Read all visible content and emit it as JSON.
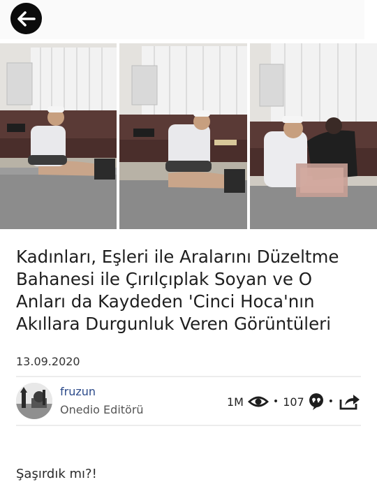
{
  "header": {
    "back_icon": "arrow-left-icon"
  },
  "article": {
    "title": "Kadınları, Eşleri ile Aralarını Düzeltme Bahanesi ile Çırılçıplak Soyan ve O Anları da Kaydeden 'Cinci Hoca'nın Akıllara Durgunluk Veren Görüntüleri",
    "date": "13.09.2020",
    "lead": "Şaşırdık mı?!"
  },
  "author": {
    "name": "fruzun",
    "role": "Onedio Editörü"
  },
  "stats": {
    "views": "1M",
    "views_icon": "eye-icon",
    "comments": "107",
    "comments_icon": "comment-quote-icon",
    "share_icon": "share-icon",
    "separator": "•"
  },
  "colors": {
    "back_button": "#0b0b0b",
    "author_link": "#2b4a8a",
    "rule": "#ececec"
  }
}
